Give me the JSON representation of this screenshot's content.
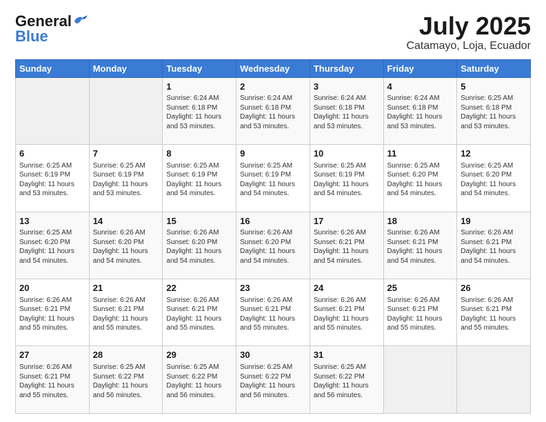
{
  "header": {
    "logo_general": "General",
    "logo_blue": "Blue",
    "title": "July 2025",
    "subtitle": "Catamayo, Loja, Ecuador"
  },
  "days_of_week": [
    "Sunday",
    "Monday",
    "Tuesday",
    "Wednesday",
    "Thursday",
    "Friday",
    "Saturday"
  ],
  "weeks": [
    [
      {
        "date": "",
        "sunrise": "",
        "sunset": "",
        "daylight": ""
      },
      {
        "date": "",
        "sunrise": "",
        "sunset": "",
        "daylight": ""
      },
      {
        "date": "1",
        "sunrise": "Sunrise: 6:24 AM",
        "sunset": "Sunset: 6:18 PM",
        "daylight": "Daylight: 11 hours and 53 minutes."
      },
      {
        "date": "2",
        "sunrise": "Sunrise: 6:24 AM",
        "sunset": "Sunset: 6:18 PM",
        "daylight": "Daylight: 11 hours and 53 minutes."
      },
      {
        "date": "3",
        "sunrise": "Sunrise: 6:24 AM",
        "sunset": "Sunset: 6:18 PM",
        "daylight": "Daylight: 11 hours and 53 minutes."
      },
      {
        "date": "4",
        "sunrise": "Sunrise: 6:24 AM",
        "sunset": "Sunset: 6:18 PM",
        "daylight": "Daylight: 11 hours and 53 minutes."
      },
      {
        "date": "5",
        "sunrise": "Sunrise: 6:25 AM",
        "sunset": "Sunset: 6:18 PM",
        "daylight": "Daylight: 11 hours and 53 minutes."
      }
    ],
    [
      {
        "date": "6",
        "sunrise": "Sunrise: 6:25 AM",
        "sunset": "Sunset: 6:19 PM",
        "daylight": "Daylight: 11 hours and 53 minutes."
      },
      {
        "date": "7",
        "sunrise": "Sunrise: 6:25 AM",
        "sunset": "Sunset: 6:19 PM",
        "daylight": "Daylight: 11 hours and 53 minutes."
      },
      {
        "date": "8",
        "sunrise": "Sunrise: 6:25 AM",
        "sunset": "Sunset: 6:19 PM",
        "daylight": "Daylight: 11 hours and 54 minutes."
      },
      {
        "date": "9",
        "sunrise": "Sunrise: 6:25 AM",
        "sunset": "Sunset: 6:19 PM",
        "daylight": "Daylight: 11 hours and 54 minutes."
      },
      {
        "date": "10",
        "sunrise": "Sunrise: 6:25 AM",
        "sunset": "Sunset: 6:19 PM",
        "daylight": "Daylight: 11 hours and 54 minutes."
      },
      {
        "date": "11",
        "sunrise": "Sunrise: 6:25 AM",
        "sunset": "Sunset: 6:20 PM",
        "daylight": "Daylight: 11 hours and 54 minutes."
      },
      {
        "date": "12",
        "sunrise": "Sunrise: 6:25 AM",
        "sunset": "Sunset: 6:20 PM",
        "daylight": "Daylight: 11 hours and 54 minutes."
      }
    ],
    [
      {
        "date": "13",
        "sunrise": "Sunrise: 6:25 AM",
        "sunset": "Sunset: 6:20 PM",
        "daylight": "Daylight: 11 hours and 54 minutes."
      },
      {
        "date": "14",
        "sunrise": "Sunrise: 6:26 AM",
        "sunset": "Sunset: 6:20 PM",
        "daylight": "Daylight: 11 hours and 54 minutes."
      },
      {
        "date": "15",
        "sunrise": "Sunrise: 6:26 AM",
        "sunset": "Sunset: 6:20 PM",
        "daylight": "Daylight: 11 hours and 54 minutes."
      },
      {
        "date": "16",
        "sunrise": "Sunrise: 6:26 AM",
        "sunset": "Sunset: 6:20 PM",
        "daylight": "Daylight: 11 hours and 54 minutes."
      },
      {
        "date": "17",
        "sunrise": "Sunrise: 6:26 AM",
        "sunset": "Sunset: 6:21 PM",
        "daylight": "Daylight: 11 hours and 54 minutes."
      },
      {
        "date": "18",
        "sunrise": "Sunrise: 6:26 AM",
        "sunset": "Sunset: 6:21 PM",
        "daylight": "Daylight: 11 hours and 54 minutes."
      },
      {
        "date": "19",
        "sunrise": "Sunrise: 6:26 AM",
        "sunset": "Sunset: 6:21 PM",
        "daylight": "Daylight: 11 hours and 54 minutes."
      }
    ],
    [
      {
        "date": "20",
        "sunrise": "Sunrise: 6:26 AM",
        "sunset": "Sunset: 6:21 PM",
        "daylight": "Daylight: 11 hours and 55 minutes."
      },
      {
        "date": "21",
        "sunrise": "Sunrise: 6:26 AM",
        "sunset": "Sunset: 6:21 PM",
        "daylight": "Daylight: 11 hours and 55 minutes."
      },
      {
        "date": "22",
        "sunrise": "Sunrise: 6:26 AM",
        "sunset": "Sunset: 6:21 PM",
        "daylight": "Daylight: 11 hours and 55 minutes."
      },
      {
        "date": "23",
        "sunrise": "Sunrise: 6:26 AM",
        "sunset": "Sunset: 6:21 PM",
        "daylight": "Daylight: 11 hours and 55 minutes."
      },
      {
        "date": "24",
        "sunrise": "Sunrise: 6:26 AM",
        "sunset": "Sunset: 6:21 PM",
        "daylight": "Daylight: 11 hours and 55 minutes."
      },
      {
        "date": "25",
        "sunrise": "Sunrise: 6:26 AM",
        "sunset": "Sunset: 6:21 PM",
        "daylight": "Daylight: 11 hours and 55 minutes."
      },
      {
        "date": "26",
        "sunrise": "Sunrise: 6:26 AM",
        "sunset": "Sunset: 6:21 PM",
        "daylight": "Daylight: 11 hours and 55 minutes."
      }
    ],
    [
      {
        "date": "27",
        "sunrise": "Sunrise: 6:26 AM",
        "sunset": "Sunset: 6:21 PM",
        "daylight": "Daylight: 11 hours and 55 minutes."
      },
      {
        "date": "28",
        "sunrise": "Sunrise: 6:25 AM",
        "sunset": "Sunset: 6:22 PM",
        "daylight": "Daylight: 11 hours and 56 minutes."
      },
      {
        "date": "29",
        "sunrise": "Sunrise: 6:25 AM",
        "sunset": "Sunset: 6:22 PM",
        "daylight": "Daylight: 11 hours and 56 minutes."
      },
      {
        "date": "30",
        "sunrise": "Sunrise: 6:25 AM",
        "sunset": "Sunset: 6:22 PM",
        "daylight": "Daylight: 11 hours and 56 minutes."
      },
      {
        "date": "31",
        "sunrise": "Sunrise: 6:25 AM",
        "sunset": "Sunset: 6:22 PM",
        "daylight": "Daylight: 11 hours and 56 minutes."
      },
      {
        "date": "",
        "sunrise": "",
        "sunset": "",
        "daylight": ""
      },
      {
        "date": "",
        "sunrise": "",
        "sunset": "",
        "daylight": ""
      }
    ]
  ]
}
